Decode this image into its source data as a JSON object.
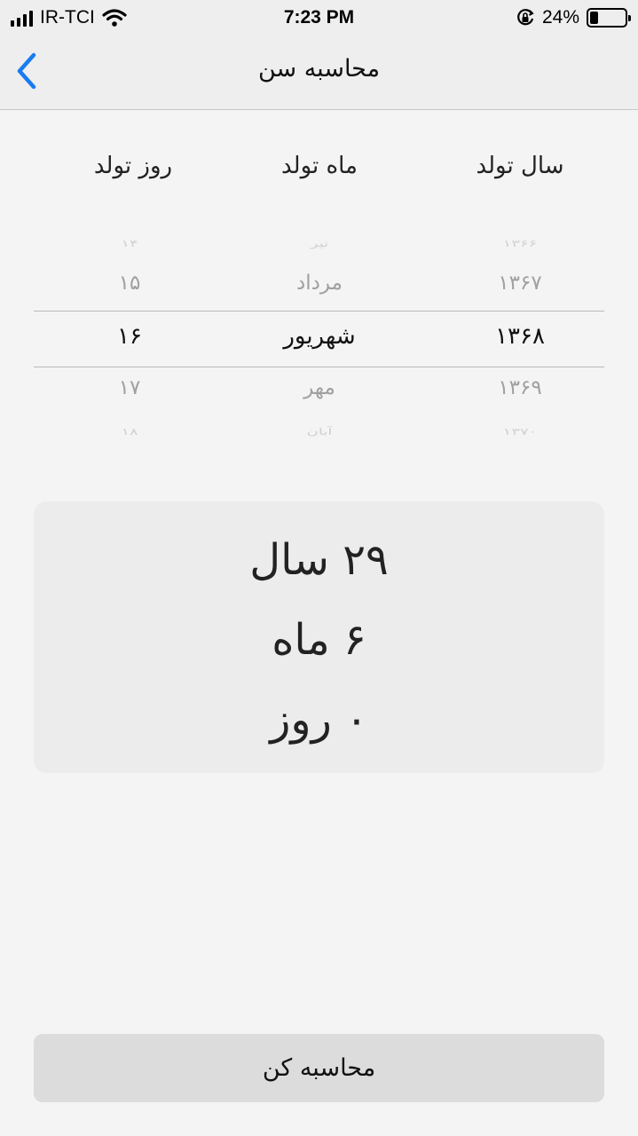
{
  "status_bar": {
    "carrier": "IR-TCI",
    "time": "7:23 PM",
    "battery_percent": "24%",
    "battery_level": 0.24
  },
  "nav": {
    "title": "محاسبه سن",
    "back_icon": "chevron-left-icon"
  },
  "columns": {
    "year": "سال تولد",
    "month": "ماه تولد",
    "day": "روز تولد"
  },
  "picker": {
    "years": [
      "۱۳۶۶",
      "۱۳۶۷",
      "۱۳۶۸",
      "۱۳۶۹",
      "۱۳۷۰"
    ],
    "months": [
      "تیر",
      "مرداد",
      "شهریور",
      "مهر",
      "آبان"
    ],
    "days": [
      "۱۴",
      "۱۵",
      "۱۶",
      "۱۷",
      "۱۸"
    ],
    "selected_index": 2
  },
  "result": {
    "years": "۲۹ سال",
    "months": "۶ ماه",
    "days": "۰ روز"
  },
  "calc_button": "محاسبه کن",
  "colors": {
    "accent": "#1a7cf0",
    "background": "#f4f4f4",
    "bar": "#eeeeee"
  }
}
